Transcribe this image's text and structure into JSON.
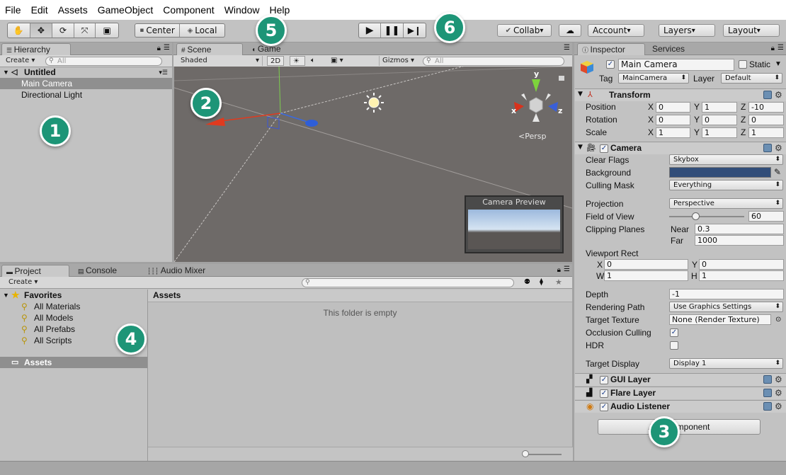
{
  "menu": [
    "File",
    "Edit",
    "Assets",
    "GameObject",
    "Component",
    "Window",
    "Help"
  ],
  "toolbar": {
    "pivot_label": "Center",
    "space_label": "Local",
    "collab_label": "Collab",
    "account_label": "Account",
    "layers_label": "Layers",
    "layout_label": "Layout"
  },
  "hierarchy": {
    "tab_label": "Hierarchy",
    "create_label": "Create",
    "search_placeholder": "All",
    "scene_name": "Untitled",
    "items": [
      "Main Camera",
      "Directional Light"
    ]
  },
  "scene": {
    "tab_scene": "Scene",
    "tab_game": "Game",
    "shading_mode": "Shaded",
    "mode_2d": "2D",
    "gizmos_label": "Gizmos",
    "search_placeholder": "All",
    "gizmo_x": "x",
    "gizmo_y": "y",
    "gizmo_z": "z",
    "persp_label": "Persp",
    "camera_preview_title": "Camera Preview"
  },
  "project": {
    "tab_project": "Project",
    "tab_console": "Console",
    "tab_audio_mixer": "Audio Mixer",
    "create_label": "Create",
    "favorites_label": "Favorites",
    "favorites": [
      "All Materials",
      "All Models",
      "All Prefabs",
      "All Scripts"
    ],
    "assets_folder": "Assets",
    "assets_header": "Assets",
    "empty_message": "This folder is empty"
  },
  "inspector": {
    "tab_inspector": "Inspector",
    "tab_services": "Services",
    "object_name": "Main Camera",
    "static_label": "Static",
    "tag_label": "Tag",
    "tag_value": "MainCamera",
    "layer_label": "Layer",
    "layer_value": "Default",
    "transform": {
      "title": "Transform",
      "position_label": "Position",
      "rotation_label": "Rotation",
      "scale_label": "Scale",
      "axis_x": "X",
      "axis_y": "Y",
      "axis_z": "Z",
      "position": [
        "0",
        "1",
        "-10"
      ],
      "rotation": [
        "0",
        "0",
        "0"
      ],
      "scale": [
        "1",
        "1",
        "1"
      ]
    },
    "camera": {
      "title": "Camera",
      "clear_flags_label": "Clear Flags",
      "clear_flags_value": "Skybox",
      "background_label": "Background",
      "background_color": "#314d79",
      "culling_mask_label": "Culling Mask",
      "culling_mask_value": "Everything",
      "projection_label": "Projection",
      "projection_value": "Perspective",
      "fov_label": "Field of View",
      "fov_value": "60",
      "clipping_label": "Clipping Planes",
      "near_label": "Near",
      "near_value": "0.3",
      "far_label": "Far",
      "far_value": "1000",
      "viewport_label": "Viewport Rect",
      "vp_x_label": "X",
      "vp_y_label": "Y",
      "vp_w_label": "W",
      "vp_h_label": "H",
      "vp_x": "0",
      "vp_y": "0",
      "vp_w": "1",
      "vp_h": "1",
      "depth_label": "Depth",
      "depth_value": "-1",
      "rendering_path_label": "Rendering Path",
      "rendering_path_value": "Use Graphics Settings",
      "target_texture_label": "Target Texture",
      "target_texture_value": "None (Render Texture)",
      "occlusion_label": "Occlusion Culling",
      "hdr_label": "HDR",
      "target_display_label": "Target Display",
      "target_display_value": "Display 1"
    },
    "components": [
      "GUI Layer",
      "Flare Layer",
      "Audio Listener"
    ],
    "add_component_label": "Add Component"
  },
  "callouts": [
    "1",
    "2",
    "3",
    "4",
    "5",
    "6"
  ],
  "colors": {
    "accent_badge": "#1d9577",
    "scene_bg": "#6e6a68",
    "selection": "#8f8f8f"
  }
}
